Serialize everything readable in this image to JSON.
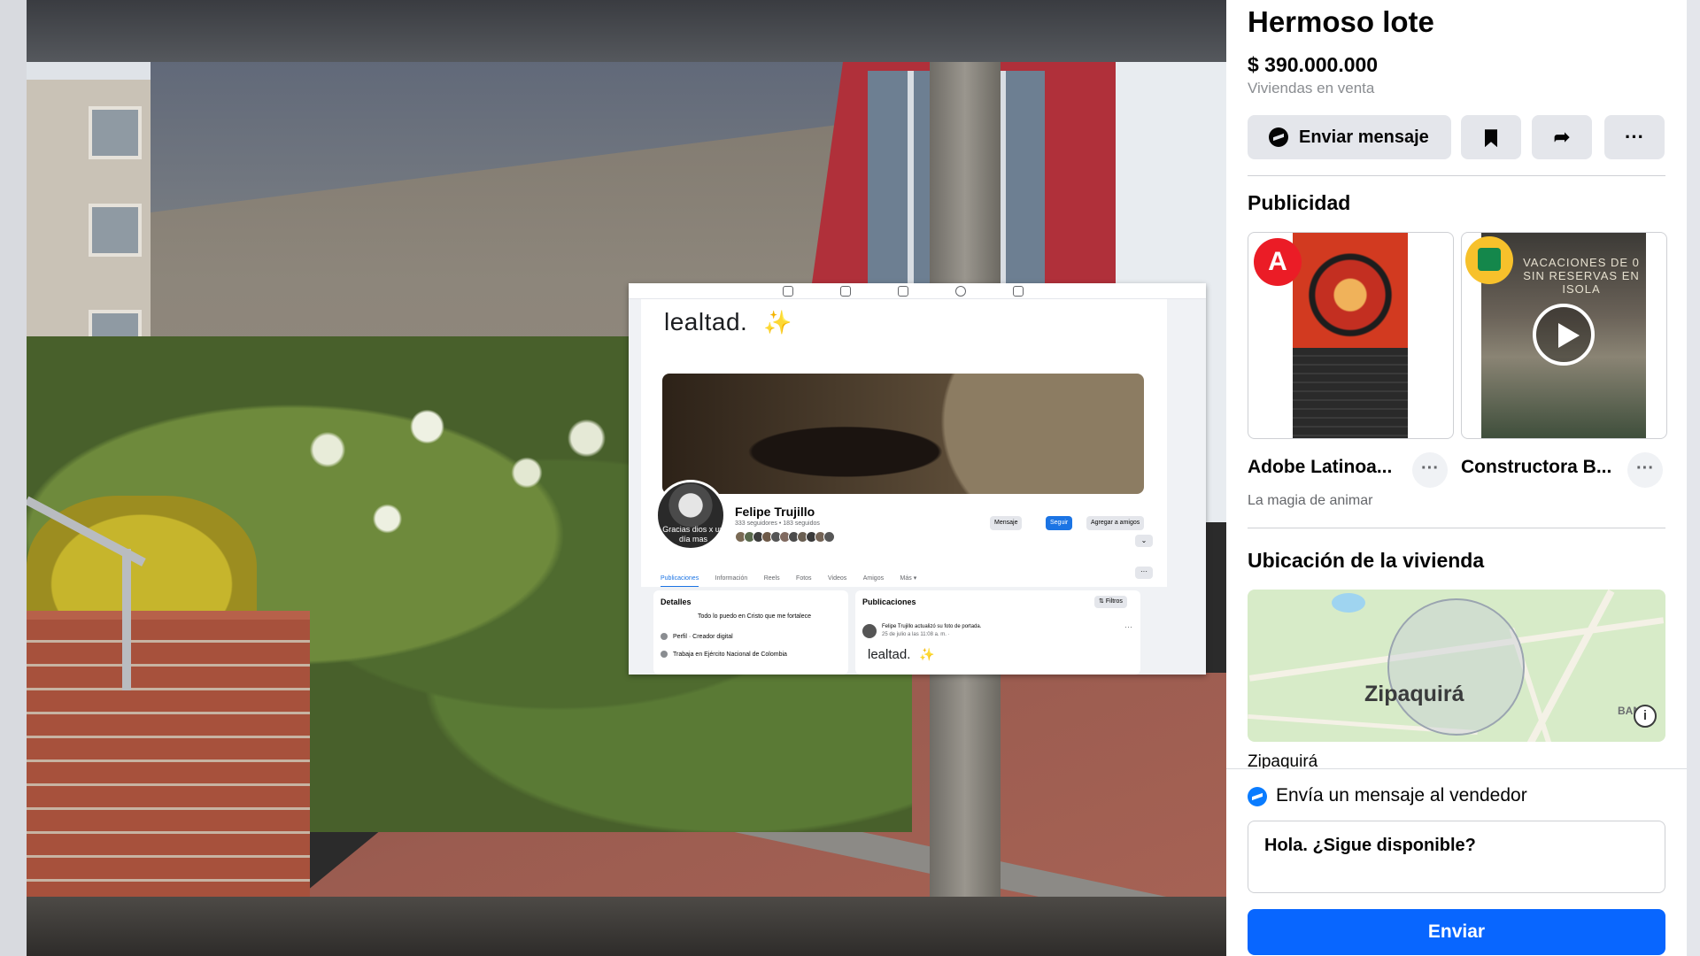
{
  "listing": {
    "title": "Hermoso lote",
    "price": "$ 390.000.000",
    "category": "Viviendas en venta",
    "message_button": "Enviar mensaje",
    "more_label": "···"
  },
  "ads": {
    "heading": "Publicidad",
    "items": [
      {
        "name": "Adobe Latinoa...",
        "subtitle": "La magia de animar",
        "logo_text": "A"
      },
      {
        "name": "Constructora B...",
        "overlay_text": "VACACIONES DE 0 SIN RESERVAS EN ISOLA"
      }
    ],
    "dots_label": "···"
  },
  "location": {
    "heading": "Ubicación de la vivienda",
    "map_city": "Zipaquirá",
    "map_edge_label": "BANDI",
    "text": "Zipaquirá"
  },
  "seller": {
    "heading": "Envía un mensaje al vendedor",
    "message_value": "Hola. ¿Sigue disponible?",
    "send_label": "Enviar"
  },
  "embed": {
    "top_text": "lealtad.",
    "sparkle": "✨",
    "avatar_text": "Gracias dios x un día mas",
    "profile_name": "Felipe Trujillo",
    "profile_sub": "333 seguidores • 183 seguidos",
    "btn_message": "Mensaje",
    "btn_follow": "Seguir",
    "btn_add": "Agregar a amigos",
    "tabs": [
      "Publicaciones",
      "Información",
      "Reels",
      "Fotos",
      "Videos",
      "Amigos",
      "Más ▾"
    ],
    "details_title": "Detalles",
    "details_bio": "Todo lo puedo en Cristo que me fortalece",
    "details_profile": "Perfil · Creador digital",
    "details_work": "Trabaja en Ejército Nacional de Colombia",
    "posts_title": "Publicaciones",
    "filters_label": "Filtros",
    "post_author": "Felipe Trujillo actualizó su foto de portada.",
    "post_date": "25 de julio a las 11:08 a. m. ·",
    "post_text": "lealtad."
  },
  "colors": {
    "primary_blue": "#0866ff",
    "messenger_blue": "#0a7cff",
    "button_grey": "#e4e6eb",
    "adobe_red": "#eb1c26"
  },
  "icons": [
    "messenger-icon",
    "bookmark-icon",
    "share-icon",
    "more-icon",
    "play-icon",
    "speaker-icon",
    "info-icon"
  ]
}
